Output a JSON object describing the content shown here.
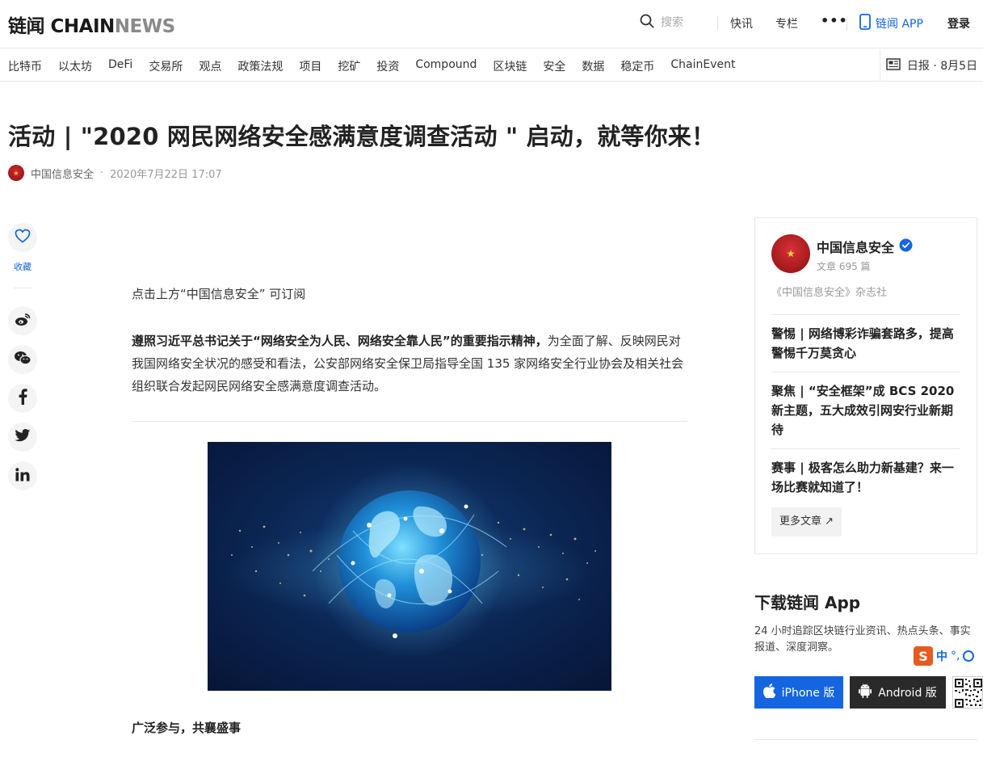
{
  "header": {
    "logo_cn": "链闻",
    "logo_chain": "CHAIN",
    "logo_news": "NEWS",
    "search_placeholder": "搜索",
    "nav_flash": "快讯",
    "nav_column": "专栏",
    "more": "•••",
    "app_label": "链闻 APP",
    "login": "登录"
  },
  "categories": [
    "比特币",
    "以太坊",
    "DeFi",
    "交易所",
    "观点",
    "政策法规",
    "项目",
    "挖矿",
    "投资",
    "Compound",
    "区块链",
    "安全",
    "数据",
    "稳定币",
    "ChainEvent"
  ],
  "daily": "日报 · 8月5日",
  "article": {
    "title": "活动 | \"2020 网民网络安全感满意度调查活动 \" 启动，就等你来！",
    "author": "中国信息安全",
    "separator": "·",
    "time": "2020年7月22日 17:07",
    "p1": "点击上方“中国信息安全” 可订阅",
    "p2_bold": "遵照习近平总书记关于“网络安全为人民、网络安全靠人民”的重要指示精神，",
    "p2_rest": "为全面了解、反映网民对我国网络安全状况的感受和看法，公安部网络安全保卫局指导全国 135 家网络安全行业协会及相关社会组织联合发起网民网络安全感满意度调查活动。",
    "subheading": "广泛参与，共襄盛事"
  },
  "sidebar": {
    "favorite_label": "收藏"
  },
  "card": {
    "author_name": "中国信息安全",
    "article_count": "文章 695 篇",
    "description": "《中国信息安全》杂志社",
    "related": [
      "警惕 | 网络博彩诈骗套路多，提高警惕千万莫贪心",
      "聚焦 | “安全框架”成 BCS 2020 新主题，五大成效引网安行业新期待",
      "赛事 | 极客怎么助力新基建？来一场比赛就知道了！"
    ],
    "more_button": "更多文章 ↗"
  },
  "download": {
    "title": "下载链闻 App",
    "desc": "24 小时追踪区块链行业资讯、热点头条、事实报道、深度洞察。",
    "ios": "iPhone 版",
    "android": "Android 版"
  },
  "ime": {
    "logo": "S",
    "zh": "中",
    "punct": "°,"
  },
  "colors": {
    "accent": "#1565e0",
    "dark_button": "#2a2a2a"
  }
}
